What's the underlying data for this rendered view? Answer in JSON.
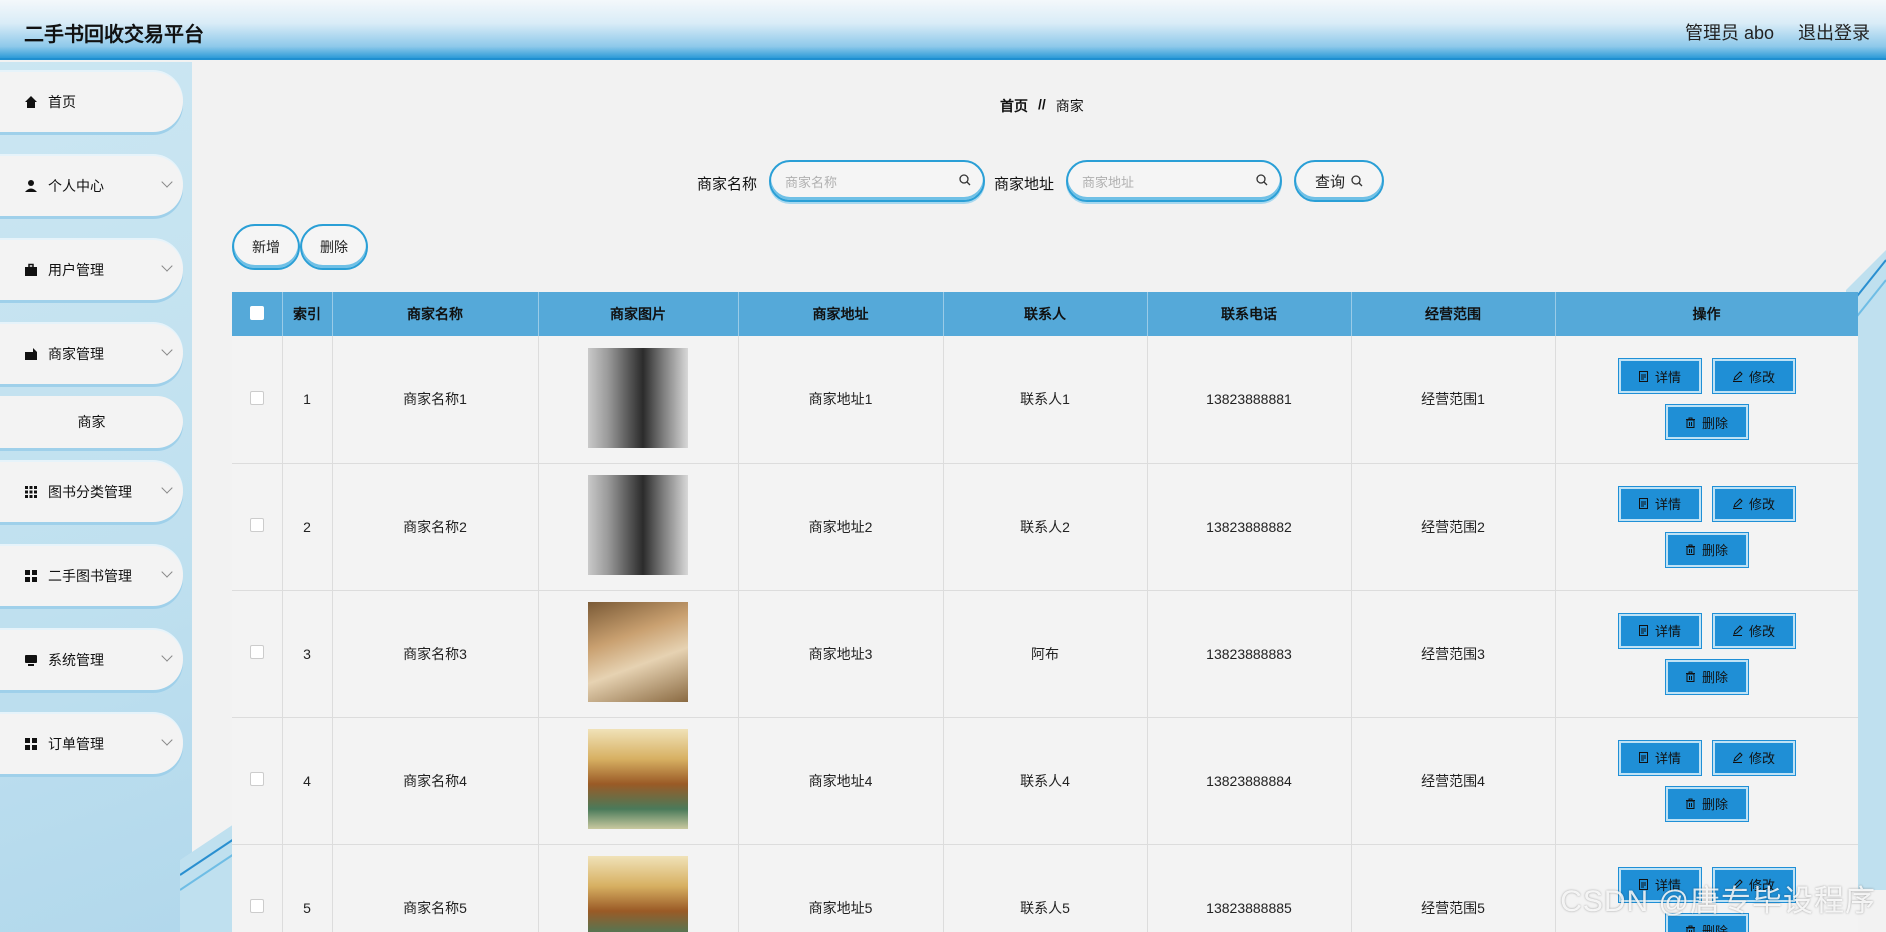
{
  "header": {
    "brand": "二手书回收交易平台",
    "user": "管理员 abo",
    "logout": "退出登录"
  },
  "sidebar": {
    "items": [
      {
        "label": "首页",
        "icon": "home-icon"
      },
      {
        "label": "个人中心",
        "icon": "user-icon"
      },
      {
        "label": "用户管理",
        "icon": "briefcase-icon"
      },
      {
        "label": "商家管理",
        "icon": "shop-icon"
      },
      {
        "label": "图书分类管理",
        "icon": "grid-icon"
      },
      {
        "label": "二手图书管理",
        "icon": "apps-icon"
      },
      {
        "label": "系统管理",
        "icon": "system-icon"
      },
      {
        "label": "订单管理",
        "icon": "apps-icon"
      }
    ],
    "sub_item": "商家"
  },
  "breadcrumb": {
    "home": "首页",
    "sep": "//",
    "current": "商家"
  },
  "search": {
    "name_label": "商家名称",
    "name_placeholder": "商家名称",
    "addr_label": "商家地址",
    "addr_placeholder": "商家地址",
    "query_label": "查询"
  },
  "actions": {
    "add": "新增",
    "delete": "删除"
  },
  "table": {
    "headers": [
      "",
      "索引",
      "商家名称",
      "商家图片",
      "商家地址",
      "联系人",
      "联系电话",
      "经营范围",
      "操作"
    ],
    "rows": [
      {
        "index": "1",
        "name": "商家名称1",
        "addr": "商家地址1",
        "contact": "联系人1",
        "phone": "13823888881",
        "scope": "经营范围1"
      },
      {
        "index": "2",
        "name": "商家名称2",
        "addr": "商家地址2",
        "contact": "联系人2",
        "phone": "13823888882",
        "scope": "经营范围2"
      },
      {
        "index": "3",
        "name": "商家名称3",
        "addr": "商家地址3",
        "contact": "阿布",
        "phone": "13823888883",
        "scope": "经营范围3"
      },
      {
        "index": "4",
        "name": "商家名称4",
        "addr": "商家地址4",
        "contact": "联系人4",
        "phone": "13823888884",
        "scope": "经营范围4"
      },
      {
        "index": "5",
        "name": "商家名称5",
        "addr": "商家地址5",
        "contact": "联系人5",
        "phone": "13823888885",
        "scope": "经营范围5"
      }
    ],
    "op_detail": "详情",
    "op_edit": "修改",
    "op_delete": "删除"
  },
  "watermark": "CSDN @唐专毕设程序",
  "colors": {
    "accent": "#1f8fd6",
    "header_bar": "#55a9d9"
  }
}
